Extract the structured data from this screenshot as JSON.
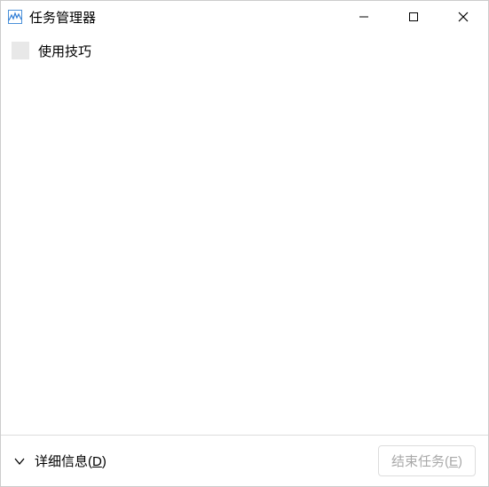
{
  "window": {
    "title": "任务管理器"
  },
  "processes": [
    {
      "name": "使用技巧"
    }
  ],
  "footer": {
    "details_label_prefix": "详细信息(",
    "details_access_key": "D",
    "details_label_suffix": ")",
    "end_task_label_prefix": "结束任务(",
    "end_task_access_key": "E",
    "end_task_label_suffix": ")"
  }
}
